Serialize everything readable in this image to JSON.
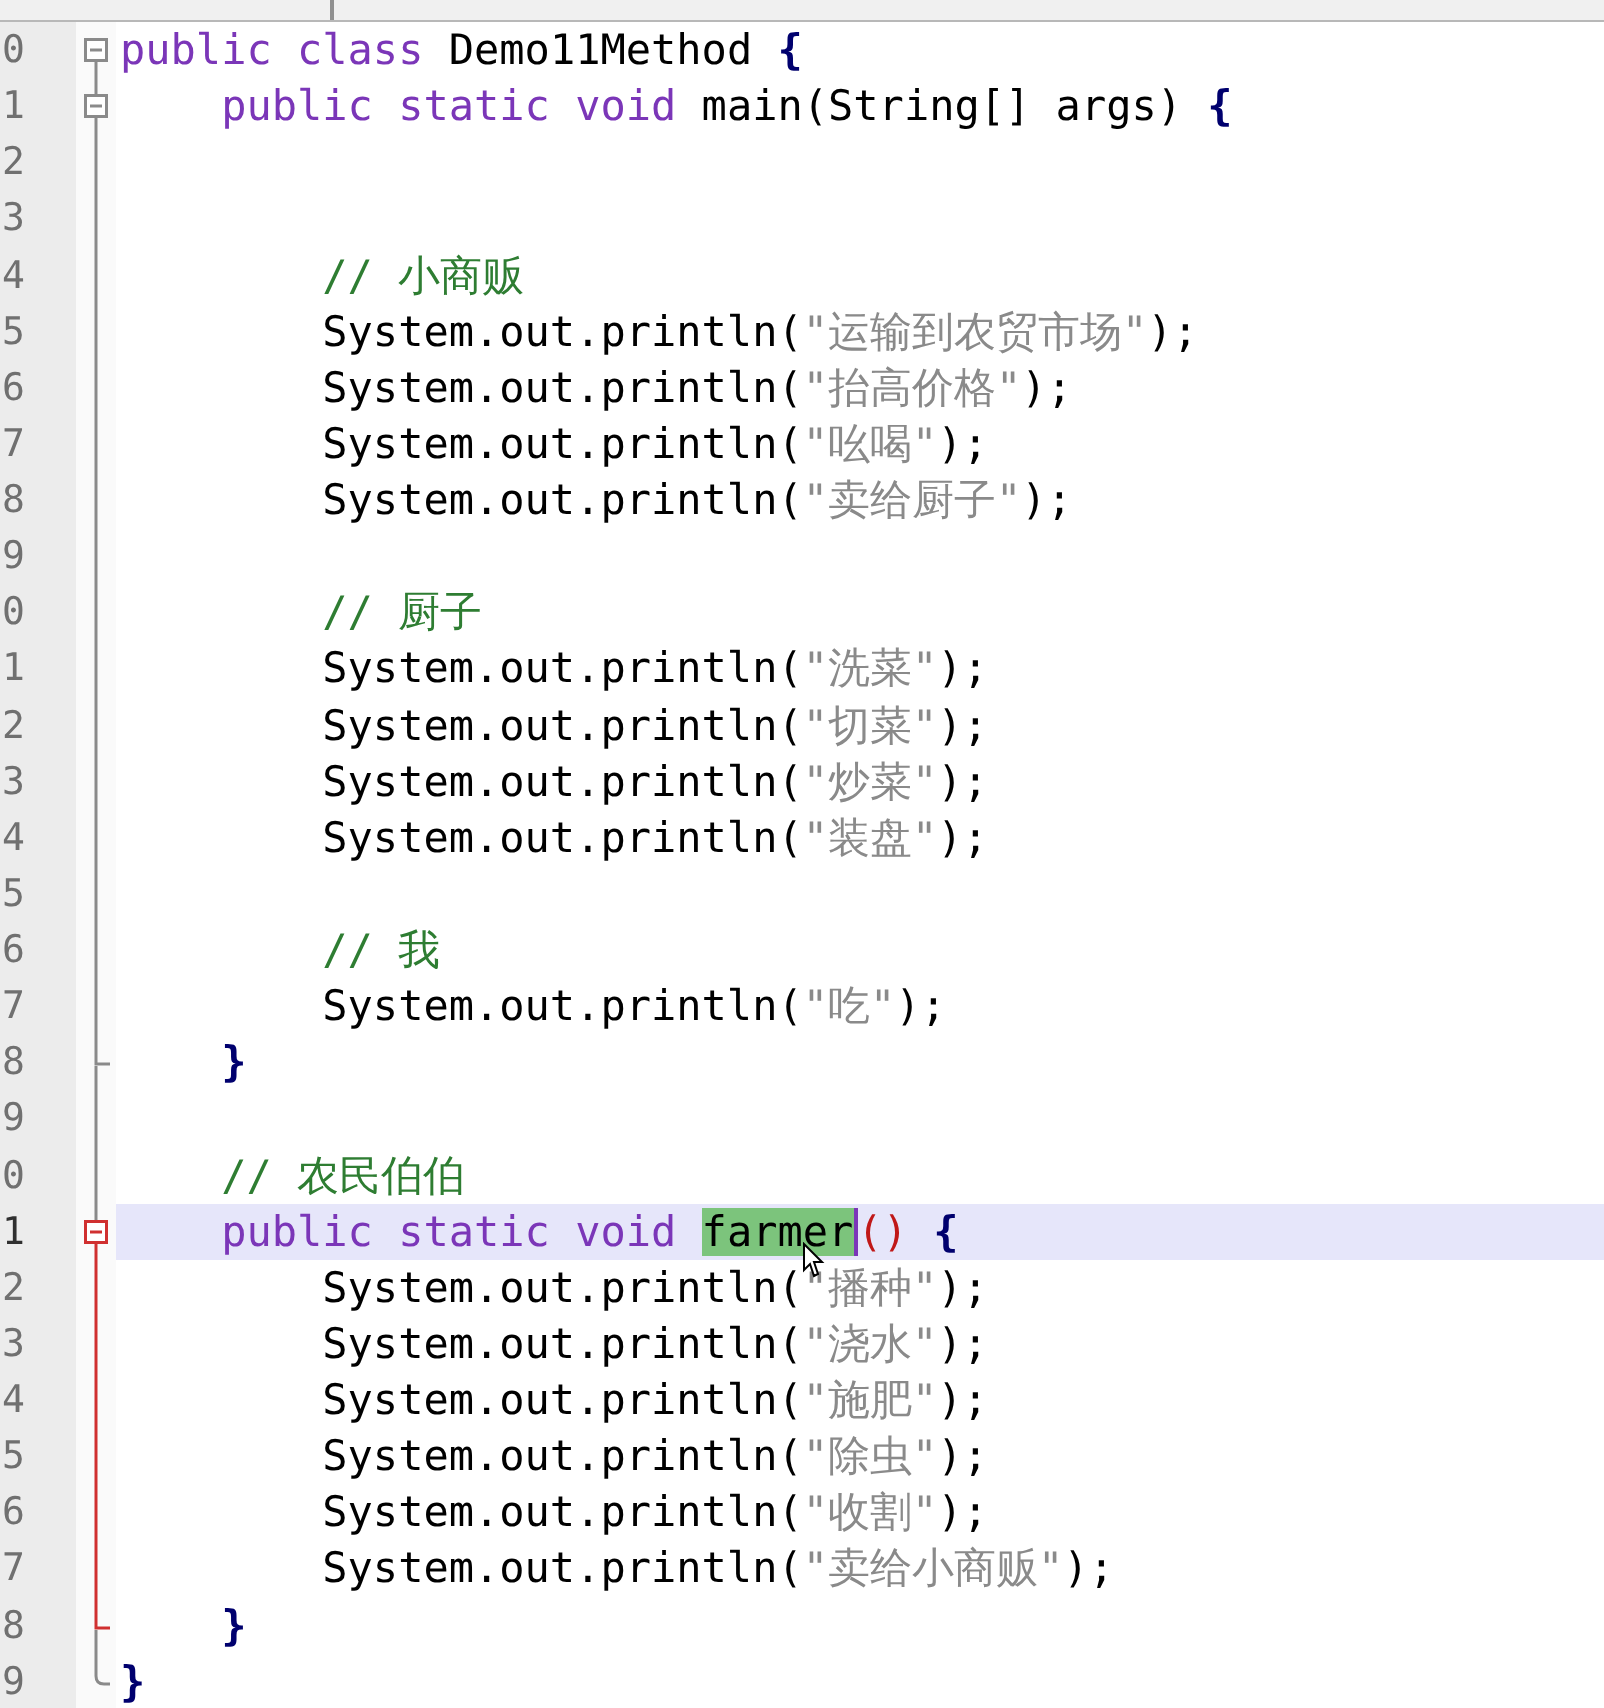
{
  "editor": {
    "lines": [
      {
        "number": "0",
        "kind": "fold-start",
        "fold_active": false,
        "current": false,
        "tokens": [
          {
            "kind": "keyword",
            "text": "public class "
          },
          {
            "kind": "plain",
            "text": "Demo11Method "
          },
          {
            "kind": "brace",
            "text": "{"
          }
        ]
      },
      {
        "number": "1",
        "kind": "fold-start",
        "fold_active": false,
        "current": false,
        "tokens": [
          {
            "kind": "keyword",
            "text": "    public static void "
          },
          {
            "kind": "plain",
            "text": "main(String[] args) "
          },
          {
            "kind": "brace",
            "text": "{"
          }
        ]
      },
      {
        "number": "2",
        "kind": "code",
        "fold_active": false,
        "current": false
      },
      {
        "number": "3",
        "kind": "code",
        "fold_active": false,
        "current": false
      },
      {
        "number": "4",
        "kind": "code",
        "fold_active": false,
        "current": false,
        "tokens": [
          {
            "kind": "comment",
            "text": "        // 小商贩"
          }
        ]
      },
      {
        "number": "5",
        "kind": "code",
        "fold_active": false,
        "current": false,
        "tokens": [
          {
            "kind": "plain",
            "text": "        System.out.println("
          },
          {
            "kind": "string",
            "text": "\"运输到农贸市场\""
          },
          {
            "kind": "plain",
            "text": ");"
          }
        ]
      },
      {
        "number": "6",
        "kind": "code",
        "fold_active": false,
        "current": false,
        "tokens": [
          {
            "kind": "plain",
            "text": "        System.out.println("
          },
          {
            "kind": "string",
            "text": "\"抬高价格\""
          },
          {
            "kind": "plain",
            "text": ");"
          }
        ]
      },
      {
        "number": "7",
        "kind": "code",
        "fold_active": false,
        "current": false,
        "tokens": [
          {
            "kind": "plain",
            "text": "        System.out.println("
          },
          {
            "kind": "string",
            "text": "\"吆喝\""
          },
          {
            "kind": "plain",
            "text": ");"
          }
        ]
      },
      {
        "number": "8",
        "kind": "code",
        "fold_active": false,
        "current": false,
        "tokens": [
          {
            "kind": "plain",
            "text": "        System.out.println("
          },
          {
            "kind": "string",
            "text": "\"卖给厨子\""
          },
          {
            "kind": "plain",
            "text": ");"
          }
        ]
      },
      {
        "number": "9",
        "kind": "code",
        "fold_active": false,
        "current": false
      },
      {
        "number": "0",
        "kind": "code",
        "fold_active": false,
        "current": false,
        "tokens": [
          {
            "kind": "comment",
            "text": "        // 厨子"
          }
        ]
      },
      {
        "number": "1",
        "kind": "code",
        "fold_active": false,
        "current": false,
        "tokens": [
          {
            "kind": "plain",
            "text": "        System.out.println("
          },
          {
            "kind": "string",
            "text": "\"洗菜\""
          },
          {
            "kind": "plain",
            "text": ");"
          }
        ]
      },
      {
        "number": "2",
        "kind": "code",
        "fold_active": false,
        "current": false,
        "tokens": [
          {
            "kind": "plain",
            "text": "        System.out.println("
          },
          {
            "kind": "string",
            "text": "\"切菜\""
          },
          {
            "kind": "plain",
            "text": ");"
          }
        ]
      },
      {
        "number": "3",
        "kind": "code",
        "fold_active": false,
        "current": false,
        "tokens": [
          {
            "kind": "plain",
            "text": "        System.out.println("
          },
          {
            "kind": "string",
            "text": "\"炒菜\""
          },
          {
            "kind": "plain",
            "text": ");"
          }
        ]
      },
      {
        "number": "4",
        "kind": "code",
        "fold_active": false,
        "current": false,
        "tokens": [
          {
            "kind": "plain",
            "text": "        System.out.println("
          },
          {
            "kind": "string",
            "text": "\"装盘\""
          },
          {
            "kind": "plain",
            "text": ");"
          }
        ]
      },
      {
        "number": "5",
        "kind": "code",
        "fold_active": false,
        "current": false
      },
      {
        "number": "6",
        "kind": "code",
        "fold_active": false,
        "current": false,
        "tokens": [
          {
            "kind": "comment",
            "text": "        // 我"
          }
        ]
      },
      {
        "number": "7",
        "kind": "code",
        "fold_active": false,
        "current": false,
        "tokens": [
          {
            "kind": "plain",
            "text": "        System.out.println("
          },
          {
            "kind": "string",
            "text": "\"吃\""
          },
          {
            "kind": "plain",
            "text": ");"
          }
        ]
      },
      {
        "number": "8",
        "kind": "fold-end",
        "fold_active": false,
        "current": false,
        "tokens": [
          {
            "kind": "brace",
            "text": "    }"
          }
        ]
      },
      {
        "number": "9",
        "kind": "code",
        "fold_active": false,
        "current": false
      },
      {
        "number": "0",
        "kind": "code",
        "fold_active": false,
        "current": false,
        "tokens": [
          {
            "kind": "comment",
            "text": "    // 农民伯伯"
          }
        ]
      },
      {
        "number": "1",
        "kind": "fold-start",
        "fold_active": true,
        "current": true,
        "tokens": [
          {
            "kind": "keyword",
            "text": "    public static void "
          },
          {
            "kind": "match",
            "text": "farmer"
          },
          {
            "kind": "paren",
            "text": "()"
          },
          {
            "kind": "brace",
            "text": " {"
          }
        ]
      },
      {
        "number": "2",
        "kind": "code",
        "fold_active": true,
        "current": false,
        "tokens": [
          {
            "kind": "plain",
            "text": "        System.out.println("
          },
          {
            "kind": "string",
            "text": "\"播种\""
          },
          {
            "kind": "plain",
            "text": ");"
          }
        ]
      },
      {
        "number": "3",
        "kind": "code",
        "fold_active": true,
        "current": false,
        "tokens": [
          {
            "kind": "plain",
            "text": "        System.out.println("
          },
          {
            "kind": "string",
            "text": "\"浇水\""
          },
          {
            "kind": "plain",
            "text": ");"
          }
        ]
      },
      {
        "number": "4",
        "kind": "code",
        "fold_active": true,
        "current": false,
        "tokens": [
          {
            "kind": "plain",
            "text": "        System.out.println("
          },
          {
            "kind": "string",
            "text": "\"施肥\""
          },
          {
            "kind": "plain",
            "text": ");"
          }
        ]
      },
      {
        "number": "5",
        "kind": "code",
        "fold_active": true,
        "current": false,
        "tokens": [
          {
            "kind": "plain",
            "text": "        System.out.println("
          },
          {
            "kind": "string",
            "text": "\"除虫\""
          },
          {
            "kind": "plain",
            "text": ");"
          }
        ]
      },
      {
        "number": "6",
        "kind": "code",
        "fold_active": true,
        "current": false,
        "tokens": [
          {
            "kind": "plain",
            "text": "        System.out.println("
          },
          {
            "kind": "string",
            "text": "\"收割\""
          },
          {
            "kind": "plain",
            "text": ");"
          }
        ]
      },
      {
        "number": "7",
        "kind": "code",
        "fold_active": true,
        "current": false,
        "tokens": [
          {
            "kind": "plain",
            "text": "        System.out.println("
          },
          {
            "kind": "string",
            "text": "\"卖给小商贩\""
          },
          {
            "kind": "plain",
            "text": ");"
          }
        ]
      },
      {
        "number": "8",
        "kind": "fold-end",
        "fold_active": true,
        "current": false,
        "tokens": [
          {
            "kind": "brace",
            "text": "    }"
          }
        ]
      },
      {
        "number": "9",
        "kind": "last-line",
        "fold_active": false,
        "current": false,
        "tokens": [
          {
            "kind": "brace",
            "text": "}"
          }
        ]
      }
    ]
  }
}
